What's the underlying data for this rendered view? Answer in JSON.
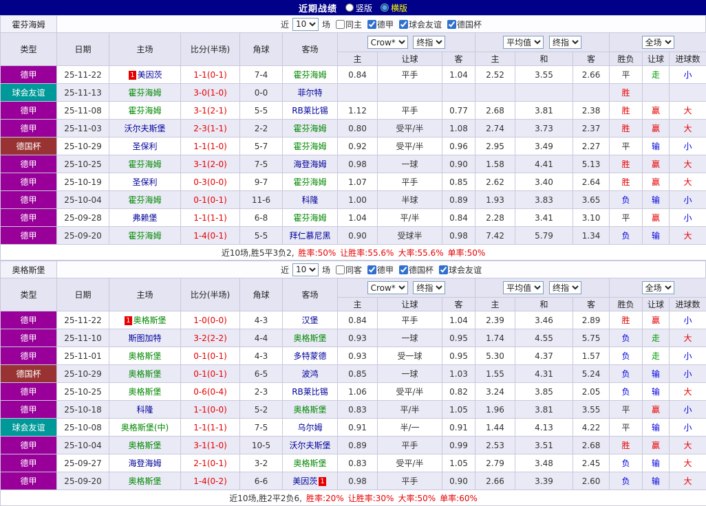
{
  "topbar": {
    "title": "近期战绩",
    "options": [
      {
        "label": "竖版",
        "selected": false
      },
      {
        "label": "横版",
        "selected": true
      }
    ]
  },
  "table_headers": {
    "type": "类型",
    "date": "日期",
    "home": "主场",
    "score": "比分(半场)",
    "corner": "角球",
    "away": "客场",
    "sub": [
      "主",
      "让球",
      "客",
      "主",
      "和",
      "客",
      "胜负",
      "让球",
      "进球数"
    ]
  },
  "colors": {
    "type_colors": {
      "德甲": "#990099",
      "球会友谊": "#009999",
      "德国杯": "#993333"
    },
    "tones": {
      "red": "#e60000",
      "blue": "#0000dd",
      "green": "#009900",
      "dark": "#333333"
    },
    "team_self": "#008800",
    "team_opponent": "#000099",
    "score": "#e60000"
  },
  "sections": [
    {
      "team": "霍芬海姆",
      "filter": {
        "near_label": "近",
        "count": "10",
        "games_label": "场",
        "same_label": "同主",
        "same_checked": false,
        "leagues": [
          {
            "label": "德甲",
            "checked": true
          },
          {
            "label": "球会友谊",
            "checked": true
          },
          {
            "label": "德国杯",
            "checked": true
          }
        ]
      },
      "dropdowns": {
        "company": "Crow*",
        "company_time": "终指",
        "average": "平均值",
        "average_time": "终指",
        "scope": "全场"
      },
      "rows": [
        {
          "type": "德甲",
          "date": "25-11-22",
          "home": {
            "name": "美因茨",
            "self": false,
            "badge": "1",
            "badge_pos": "before"
          },
          "score": "1-1(0-1)",
          "corner": "7-4",
          "away": {
            "name": "霍芬海姆",
            "self": true
          },
          "odds": [
            "0.84",
            "平手",
            "1.04",
            "2.52",
            "3.55",
            "2.66"
          ],
          "results": [
            {
              "text": "平",
              "tone": "dark"
            },
            {
              "text": "走",
              "tone": "green"
            },
            {
              "text": "小",
              "tone": "blue"
            }
          ]
        },
        {
          "type": "球会友谊",
          "date": "25-11-13",
          "home": {
            "name": "霍芬海姆",
            "self": true
          },
          "score": "3-0(1-0)",
          "corner": "0-0",
          "away": {
            "name": "菲尔特",
            "self": false
          },
          "odds": [
            "",
            "",
            "",
            "",
            "",
            ""
          ],
          "results": [
            {
              "text": "胜",
              "tone": "red"
            },
            {
              "text": "",
              "tone": "dark"
            },
            {
              "text": "",
              "tone": "dark"
            }
          ]
        },
        {
          "type": "德甲",
          "date": "25-11-08",
          "home": {
            "name": "霍芬海姆",
            "self": true
          },
          "score": "3-1(2-1)",
          "corner": "5-5",
          "away": {
            "name": "RB莱比锡",
            "self": false
          },
          "odds": [
            "1.12",
            "平手",
            "0.77",
            "2.68",
            "3.81",
            "2.38"
          ],
          "results": [
            {
              "text": "胜",
              "tone": "red"
            },
            {
              "text": "赢",
              "tone": "red"
            },
            {
              "text": "大",
              "tone": "red"
            }
          ]
        },
        {
          "type": "德甲",
          "date": "25-11-03",
          "home": {
            "name": "沃尔夫斯堡",
            "self": false
          },
          "score": "2-3(1-1)",
          "corner": "2-2",
          "away": {
            "name": "霍芬海姆",
            "self": true
          },
          "odds": [
            "0.80",
            "受平/半",
            "1.08",
            "2.74",
            "3.73",
            "2.37"
          ],
          "results": [
            {
              "text": "胜",
              "tone": "red"
            },
            {
              "text": "赢",
              "tone": "red"
            },
            {
              "text": "大",
              "tone": "red"
            }
          ]
        },
        {
          "type": "德国杯",
          "date": "25-10-29",
          "home": {
            "name": "圣保利",
            "self": false
          },
          "score": "1-1(1-0)",
          "corner": "5-7",
          "away": {
            "name": "霍芬海姆",
            "self": true
          },
          "odds": [
            "0.92",
            "受平/半",
            "0.96",
            "2.95",
            "3.49",
            "2.27"
          ],
          "results": [
            {
              "text": "平",
              "tone": "dark"
            },
            {
              "text": "输",
              "tone": "blue"
            },
            {
              "text": "小",
              "tone": "blue"
            }
          ]
        },
        {
          "type": "德甲",
          "date": "25-10-25",
          "home": {
            "name": "霍芬海姆",
            "self": true
          },
          "score": "3-1(2-0)",
          "corner": "7-5",
          "away": {
            "name": "海登海姆",
            "self": false
          },
          "odds": [
            "0.98",
            "一球",
            "0.90",
            "1.58",
            "4.41",
            "5.13"
          ],
          "results": [
            {
              "text": "胜",
              "tone": "red"
            },
            {
              "text": "赢",
              "tone": "red"
            },
            {
              "text": "大",
              "tone": "red"
            }
          ]
        },
        {
          "type": "德甲",
          "date": "25-10-19",
          "home": {
            "name": "圣保利",
            "self": false
          },
          "score": "0-3(0-0)",
          "corner": "9-7",
          "away": {
            "name": "霍芬海姆",
            "self": true
          },
          "odds": [
            "1.07",
            "平手",
            "0.85",
            "2.62",
            "3.40",
            "2.64"
          ],
          "results": [
            {
              "text": "胜",
              "tone": "red"
            },
            {
              "text": "赢",
              "tone": "red"
            },
            {
              "text": "大",
              "tone": "red"
            }
          ]
        },
        {
          "type": "德甲",
          "date": "25-10-04",
          "home": {
            "name": "霍芬海姆",
            "self": true
          },
          "score": "0-1(0-1)",
          "corner": "11-6",
          "away": {
            "name": "科隆",
            "self": false
          },
          "odds": [
            "1.00",
            "半球",
            "0.89",
            "1.93",
            "3.83",
            "3.65"
          ],
          "results": [
            {
              "text": "负",
              "tone": "blue"
            },
            {
              "text": "输",
              "tone": "blue"
            },
            {
              "text": "小",
              "tone": "blue"
            }
          ]
        },
        {
          "type": "德甲",
          "date": "25-09-28",
          "home": {
            "name": "弗赖堡",
            "self": false
          },
          "score": "1-1(1-1)",
          "corner": "6-8",
          "away": {
            "name": "霍芬海姆",
            "self": true
          },
          "odds": [
            "1.04",
            "平/半",
            "0.84",
            "2.28",
            "3.41",
            "3.10"
          ],
          "results": [
            {
              "text": "平",
              "tone": "dark"
            },
            {
              "text": "赢",
              "tone": "red"
            },
            {
              "text": "小",
              "tone": "blue"
            }
          ]
        },
        {
          "type": "德甲",
          "date": "25-09-20",
          "home": {
            "name": "霍芬海姆",
            "self": true
          },
          "score": "1-4(0-1)",
          "corner": "5-5",
          "away": {
            "name": "拜仁慕尼黑",
            "self": false
          },
          "odds": [
            "0.90",
            "受球半",
            "0.98",
            "7.42",
            "5.79",
            "1.34"
          ],
          "results": [
            {
              "text": "负",
              "tone": "blue"
            },
            {
              "text": "输",
              "tone": "blue"
            },
            {
              "text": "大",
              "tone": "red"
            }
          ]
        }
      ],
      "summary": [
        {
          "text": "近10场,胜5平3负2,",
          "tone": "dark"
        },
        {
          "text": "胜率:50%",
          "tone": "red"
        },
        {
          "text": "让胜率:55.6%",
          "tone": "red"
        },
        {
          "text": "大率:55.6%",
          "tone": "red"
        },
        {
          "text": "单率:50%",
          "tone": "red"
        }
      ]
    },
    {
      "team": "奥格斯堡",
      "filter": {
        "near_label": "近",
        "count": "10",
        "games_label": "场",
        "same_label": "同客",
        "same_checked": false,
        "leagues": [
          {
            "label": "德甲",
            "checked": true
          },
          {
            "label": "德国杯",
            "checked": true
          },
          {
            "label": "球会友谊",
            "checked": true
          }
        ]
      },
      "dropdowns": {
        "company": "Crow*",
        "company_time": "终指",
        "average": "平均值",
        "average_time": "终指",
        "scope": "全场"
      },
      "rows": [
        {
          "type": "德甲",
          "date": "25-11-22",
          "home": {
            "name": "奥格斯堡",
            "self": true,
            "badge": "1",
            "badge_pos": "before"
          },
          "score": "1-0(0-0)",
          "corner": "4-3",
          "away": {
            "name": "汉堡",
            "self": false
          },
          "odds": [
            "0.84",
            "平手",
            "1.04",
            "2.39",
            "3.46",
            "2.89"
          ],
          "results": [
            {
              "text": "胜",
              "tone": "red"
            },
            {
              "text": "赢",
              "tone": "red"
            },
            {
              "text": "小",
              "tone": "blue"
            }
          ]
        },
        {
          "type": "德甲",
          "date": "25-11-10",
          "home": {
            "name": "斯图加特",
            "self": false
          },
          "score": "3-2(2-2)",
          "corner": "4-4",
          "away": {
            "name": "奥格斯堡",
            "self": true
          },
          "odds": [
            "0.93",
            "一球",
            "0.95",
            "1.74",
            "4.55",
            "5.75"
          ],
          "results": [
            {
              "text": "负",
              "tone": "blue"
            },
            {
              "text": "走",
              "tone": "green"
            },
            {
              "text": "大",
              "tone": "red"
            }
          ]
        },
        {
          "type": "德甲",
          "date": "25-11-01",
          "home": {
            "name": "奥格斯堡",
            "self": true
          },
          "score": "0-1(0-1)",
          "corner": "4-3",
          "away": {
            "name": "多特蒙德",
            "self": false
          },
          "odds": [
            "0.93",
            "受一球",
            "0.95",
            "5.30",
            "4.37",
            "1.57"
          ],
          "results": [
            {
              "text": "负",
              "tone": "blue"
            },
            {
              "text": "走",
              "tone": "green"
            },
            {
              "text": "小",
              "tone": "blue"
            }
          ]
        },
        {
          "type": "德国杯",
          "date": "25-10-29",
          "home": {
            "name": "奥格斯堡",
            "self": true
          },
          "score": "0-1(0-1)",
          "corner": "6-5",
          "away": {
            "name": "波鸿",
            "self": false
          },
          "odds": [
            "0.85",
            "一球",
            "1.03",
            "1.55",
            "4.31",
            "5.24"
          ],
          "results": [
            {
              "text": "负",
              "tone": "blue"
            },
            {
              "text": "输",
              "tone": "blue"
            },
            {
              "text": "小",
              "tone": "blue"
            }
          ]
        },
        {
          "type": "德甲",
          "date": "25-10-25",
          "home": {
            "name": "奥格斯堡",
            "self": true
          },
          "score": "0-6(0-4)",
          "corner": "2-3",
          "away": {
            "name": "RB莱比锡",
            "self": false
          },
          "odds": [
            "1.06",
            "受平/半",
            "0.82",
            "3.24",
            "3.85",
            "2.05"
          ],
          "results": [
            {
              "text": "负",
              "tone": "blue"
            },
            {
              "text": "输",
              "tone": "blue"
            },
            {
              "text": "大",
              "tone": "red"
            }
          ]
        },
        {
          "type": "德甲",
          "date": "25-10-18",
          "home": {
            "name": "科隆",
            "self": false
          },
          "score": "1-1(0-0)",
          "corner": "5-2",
          "away": {
            "name": "奥格斯堡",
            "self": true
          },
          "odds": [
            "0.83",
            "平/半",
            "1.05",
            "1.96",
            "3.81",
            "3.55"
          ],
          "results": [
            {
              "text": "平",
              "tone": "dark"
            },
            {
              "text": "赢",
              "tone": "red"
            },
            {
              "text": "小",
              "tone": "blue"
            }
          ]
        },
        {
          "type": "球会友谊",
          "date": "25-10-08",
          "home": {
            "name": "奥格斯堡(中)",
            "self": true
          },
          "score": "1-1(1-1)",
          "corner": "7-5",
          "away": {
            "name": "乌尔姆",
            "self": false
          },
          "odds": [
            "0.91",
            "半/一",
            "0.91",
            "1.44",
            "4.13",
            "4.22"
          ],
          "results": [
            {
              "text": "平",
              "tone": "dark"
            },
            {
              "text": "输",
              "tone": "blue"
            },
            {
              "text": "小",
              "tone": "blue"
            }
          ]
        },
        {
          "type": "德甲",
          "date": "25-10-04",
          "home": {
            "name": "奥格斯堡",
            "self": true
          },
          "score": "3-1(1-0)",
          "corner": "10-5",
          "away": {
            "name": "沃尔夫斯堡",
            "self": false
          },
          "odds": [
            "0.89",
            "平手",
            "0.99",
            "2.53",
            "3.51",
            "2.68"
          ],
          "results": [
            {
              "text": "胜",
              "tone": "red"
            },
            {
              "text": "赢",
              "tone": "red"
            },
            {
              "text": "大",
              "tone": "red"
            }
          ]
        },
        {
          "type": "德甲",
          "date": "25-09-27",
          "home": {
            "name": "海登海姆",
            "self": false
          },
          "score": "2-1(0-1)",
          "corner": "3-2",
          "away": {
            "name": "奥格斯堡",
            "self": true
          },
          "odds": [
            "0.83",
            "受平/半",
            "1.05",
            "2.79",
            "3.48",
            "2.45"
          ],
          "results": [
            {
              "text": "负",
              "tone": "blue"
            },
            {
              "text": "输",
              "tone": "blue"
            },
            {
              "text": "大",
              "tone": "red"
            }
          ]
        },
        {
          "type": "德甲",
          "date": "25-09-20",
          "home": {
            "name": "奥格斯堡",
            "self": true
          },
          "score": "1-4(0-2)",
          "corner": "6-6",
          "away": {
            "name": "美因茨",
            "self": false,
            "badge": "1",
            "badge_pos": "after"
          },
          "odds": [
            "0.98",
            "平手",
            "0.90",
            "2.66",
            "3.39",
            "2.60"
          ],
          "results": [
            {
              "text": "负",
              "tone": "blue"
            },
            {
              "text": "输",
              "tone": "blue"
            },
            {
              "text": "大",
              "tone": "red"
            }
          ]
        }
      ],
      "summary": [
        {
          "text": "近10场,胜2平2负6,",
          "tone": "dark"
        },
        {
          "text": "胜率:20%",
          "tone": "red"
        },
        {
          "text": "让胜率:30%",
          "tone": "red"
        },
        {
          "text": "大率:50%",
          "tone": "red"
        },
        {
          "text": "单率:60%",
          "tone": "red"
        }
      ]
    }
  ]
}
